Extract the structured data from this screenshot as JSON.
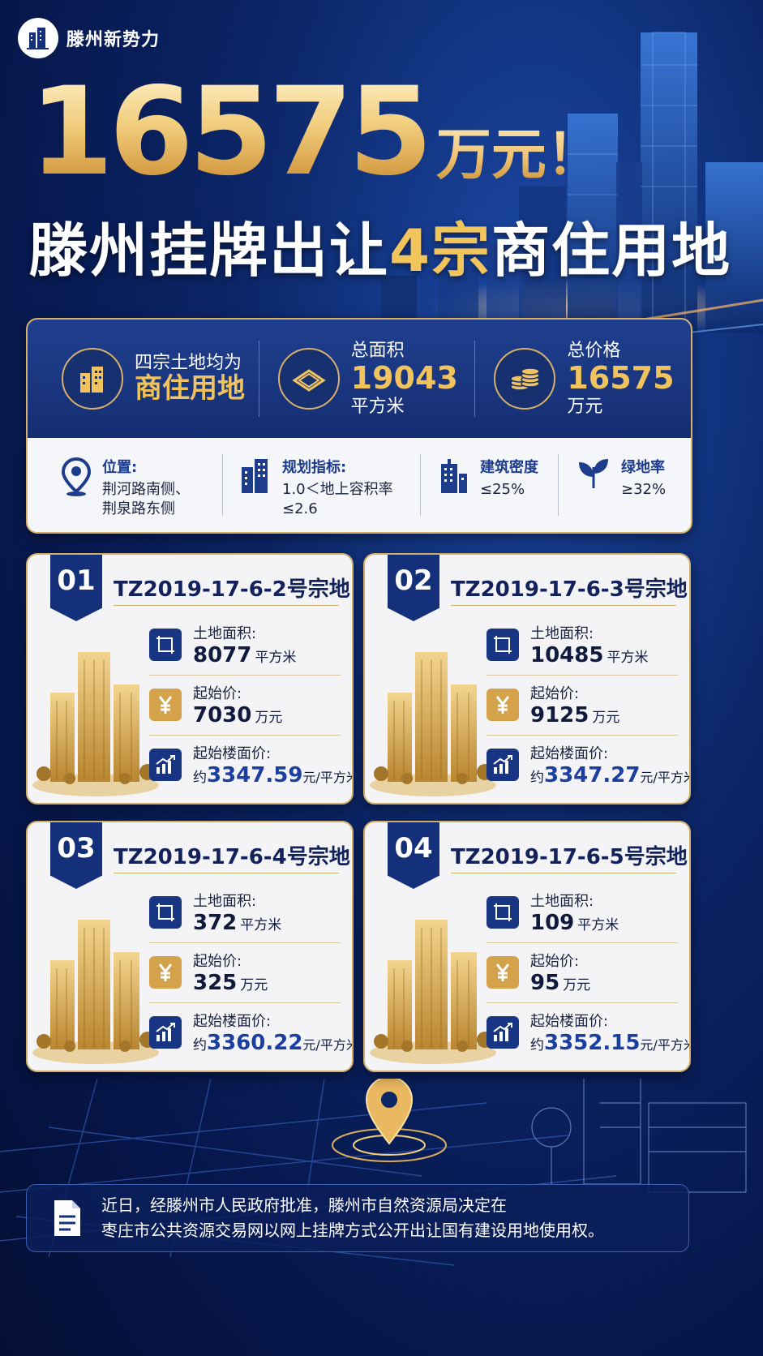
{
  "brand": {
    "name": "滕州新势力"
  },
  "headline": {
    "big_number": "16575",
    "big_unit": "万元！",
    "line2_part1": "滕州挂牌出让",
    "line2_highlight": "4宗",
    "line2_part2": "商住用地"
  },
  "summary": {
    "use_label": "四宗土地均为",
    "use_value": "商住用地",
    "area_label": "总面积",
    "area_value": "19043",
    "area_unit": "平方米",
    "price_label": "总价格",
    "price_value": "16575",
    "price_unit": "万元"
  },
  "attributes": [
    {
      "title": "位置:",
      "lines": [
        "荆河路南侧、",
        "荆泉路东侧"
      ],
      "icon": "location-pin-icon"
    },
    {
      "title": "规划指标:",
      "lines": [
        "1.0＜地上容积率",
        "≤2.6"
      ],
      "icon": "building-icon"
    },
    {
      "title": "建筑密度",
      "lines": [
        "≤25%"
      ],
      "icon": "building-density-icon"
    },
    {
      "title": "绿地率",
      "lines": [
        "≥32%"
      ],
      "icon": "leaf-icon"
    }
  ],
  "metric_labels": {
    "area": "土地面积:",
    "start_price": "起始价:",
    "floor_price": "起始楼面价:"
  },
  "units": {
    "area": "平方米",
    "price": "万元",
    "floor_prefix": "约",
    "floor": "元/平方米"
  },
  "parcels": [
    {
      "badge": "01",
      "code": "TZ2019-17-6-2号宗地",
      "area": "8077",
      "start_price": "7030",
      "floor_price": "3347.59"
    },
    {
      "badge": "02",
      "code": "TZ2019-17-6-3号宗地",
      "area": "10485",
      "start_price": "9125",
      "floor_price": "3347.27"
    },
    {
      "badge": "03",
      "code": "TZ2019-17-6-4号宗地",
      "area": "372",
      "start_price": "325",
      "floor_price": "3360.22"
    },
    {
      "badge": "04",
      "code": "TZ2019-17-6-5号宗地",
      "area": "109",
      "start_price": "95",
      "floor_price": "3352.15"
    }
  ],
  "footer": {
    "line1": "近日，经滕州市人民政府批准，滕州市自然资源局决定在",
    "line2": "枣庄市公共资源交易网以网上挂牌方式公开出让国有建设用地使用权。"
  },
  "colors": {
    "gold": "#f0c35f",
    "navy": "#14307a",
    "background": "#0b2566"
  }
}
